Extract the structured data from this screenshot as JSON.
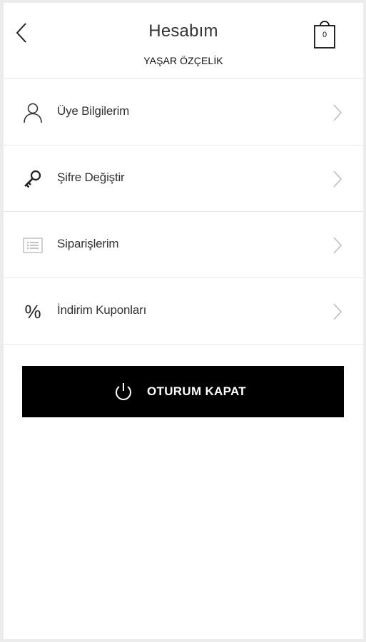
{
  "header": {
    "title": "Hesabım",
    "user_name": "YAŞAR ÖZÇELİK",
    "cart_count": "0"
  },
  "menu": {
    "items": [
      {
        "label": "Üye Bilgilerim",
        "icon": "user-icon"
      },
      {
        "label": "Şifre Değiştir",
        "icon": "key-icon"
      },
      {
        "label": "Siparişlerim",
        "icon": "order-list-icon"
      },
      {
        "label": "İndirim Kuponları",
        "icon": "percent-icon",
        "glyph": "%"
      }
    ]
  },
  "logout": {
    "label": "OTURUM KAPAT",
    "icon": "power-icon"
  },
  "colors": {
    "background": "#ececec",
    "panel": "#ffffff",
    "divider": "#e6e6e6",
    "button": "#000000",
    "button_text": "#ffffff",
    "chevron": "#bdbdbd"
  }
}
